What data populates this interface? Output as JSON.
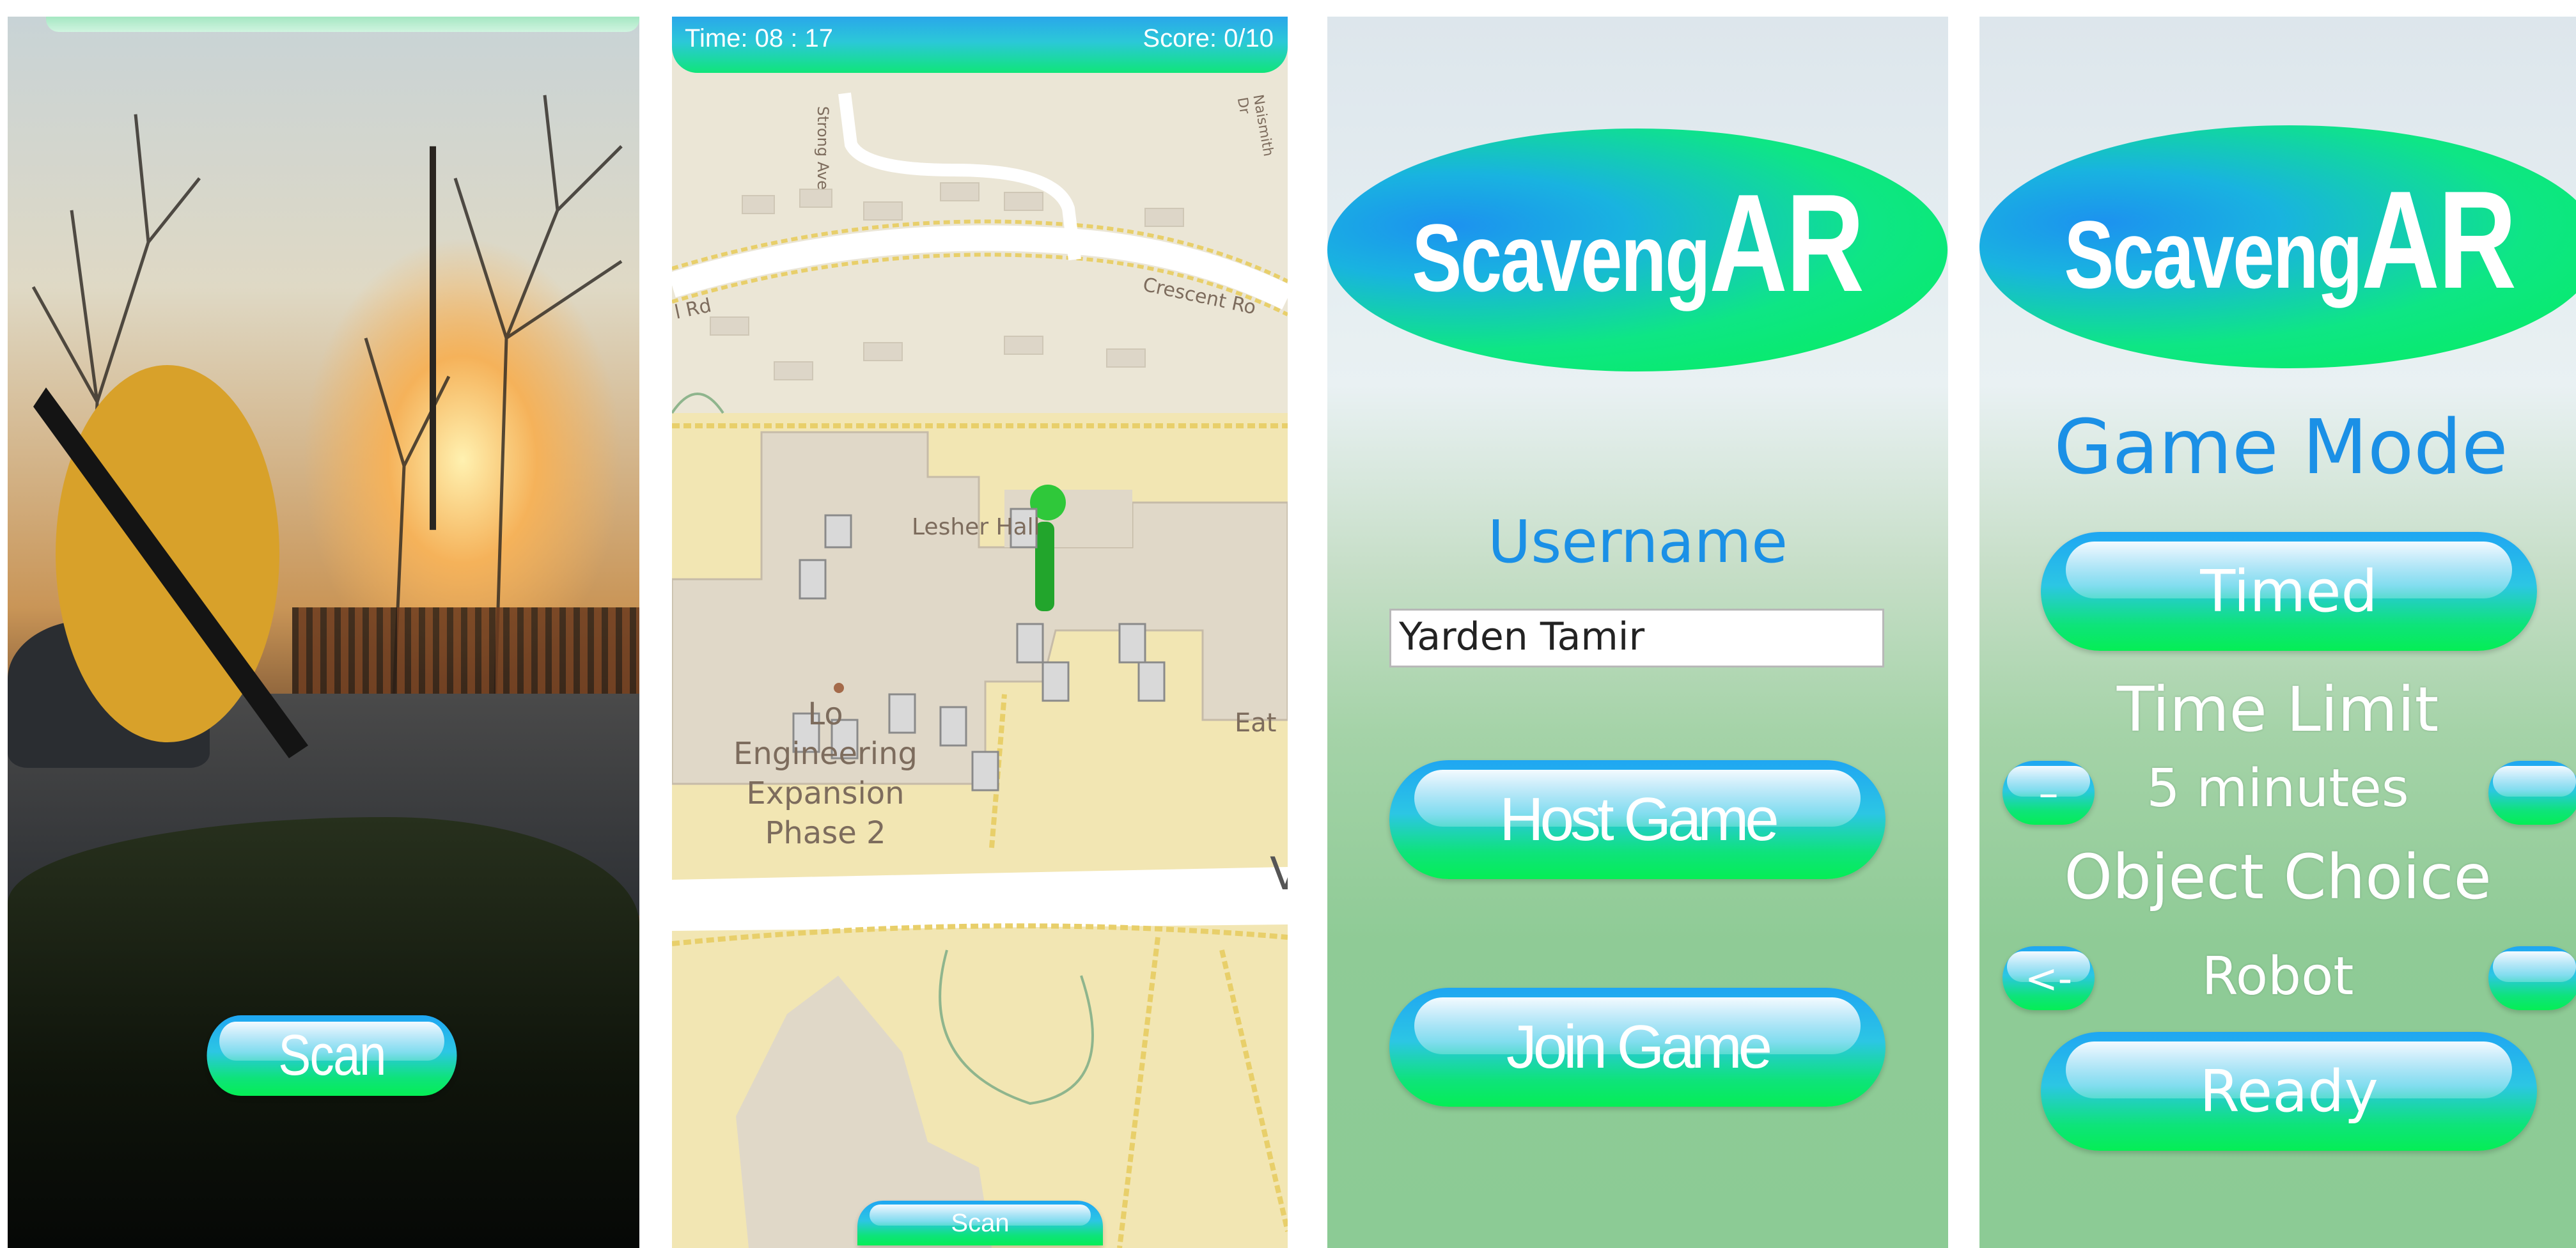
{
  "panel1": {
    "scan_label": "Scan"
  },
  "panel2": {
    "hud": {
      "time": "Time: 08 : 17",
      "score": "Score: 0/10"
    },
    "map_labels": {
      "strong_ave": "Strong Ave",
      "crescent": "Crescent Ro",
      "rd": "l Rd",
      "naismith": "Naismith Dr",
      "lesher": "Lesher Hall",
      "engineering": "Lo\nEngineering\nExpansion\nPhase 2",
      "eat": "Eat",
      "v": "V"
    },
    "scan_label": "Scan"
  },
  "panel3": {
    "logo": {
      "prefix": "Scaveng",
      "suffix": "AR"
    },
    "username_title": "Username",
    "username_value": "Yarden Tamir",
    "host_label": "Host Game",
    "join_label": "Join Game"
  },
  "panel4": {
    "logo": {
      "prefix": "Scaveng",
      "suffix": "AR"
    },
    "game_mode_title": "Game Mode",
    "mode_button": "Timed",
    "time_limit_label": "Time Limit",
    "time_limit_value": "5 minutes",
    "decrease_label": "–",
    "increase_label": "",
    "object_choice_label": "Object Choice",
    "object_value": "Robot",
    "prev_label": "<-",
    "next_label": "",
    "ready_label": "Ready"
  },
  "colors": {
    "accent_blue": "#1b90e6",
    "accent_green": "#05ee55",
    "ar_object": "#d8a12a"
  },
  "icons": [
    "player-marker-icon",
    "robot-icon"
  ]
}
